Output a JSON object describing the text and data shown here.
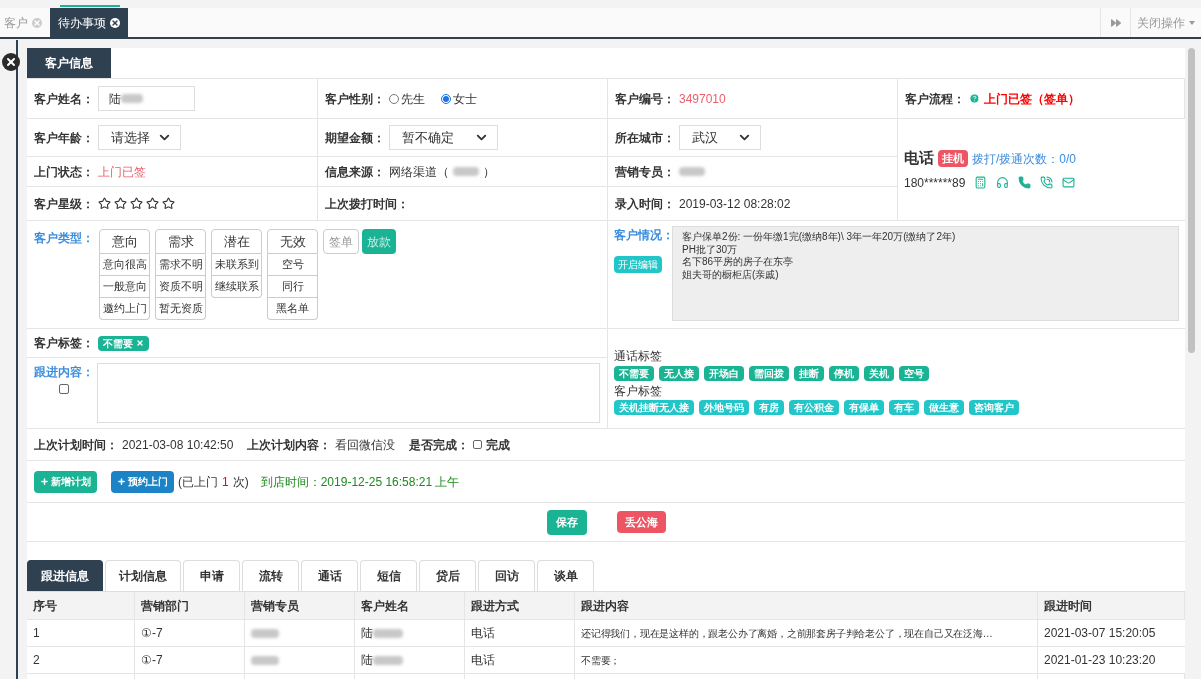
{
  "top_tabs": [
    {
      "label": "客户",
      "selected": false
    },
    {
      "label": "待办事项",
      "selected": true
    }
  ],
  "close_menu": "关闭操作",
  "panel_tab": "客户信息",
  "name": {
    "label": "客户姓名：",
    "value": "陆"
  },
  "gender": {
    "label": "客户性别：",
    "options": [
      {
        "label": "先生",
        "selected": false
      },
      {
        "label": "女士",
        "selected": true
      }
    ]
  },
  "number": {
    "label": "客户编号：",
    "value": "3497010"
  },
  "flow": {
    "label": "客户流程：",
    "value": "上门已签（签单）"
  },
  "age": {
    "label": "客户年龄：",
    "value": "请选择"
  },
  "amount": {
    "label": "期望金额：",
    "value": "暂不确定"
  },
  "city": {
    "label": "所在城市：",
    "value": "武汉"
  },
  "visit_status": {
    "label": "上门状态：",
    "value": "上门已签"
  },
  "source": {
    "label": "信息来源：",
    "value": "网络渠道（",
    "close": "）"
  },
  "sales": {
    "label": "营销专员："
  },
  "rating": {
    "label": "客户星级：",
    "stars": 0
  },
  "last_call": {
    "label": "上次拨打时间："
  },
  "created": {
    "label": "录入时间：",
    "value": "2019-03-12 08:28:02"
  },
  "phone": {
    "title": "电话",
    "hangup": "挂机",
    "counts": "拨打/拨通次数：0/0",
    "number": "180******89"
  },
  "customer_type": {
    "label": "客户类型：",
    "groups": [
      {
        "title": "意向",
        "items": [
          "意向很高",
          "一般意向",
          "邀约上门"
        ]
      },
      {
        "title": "需求",
        "items": [
          "需求不明",
          "资质不明",
          "暂无资质"
        ]
      },
      {
        "title": "潜在",
        "items": [
          "未联系到",
          "继续联系"
        ]
      },
      {
        "title": "无效",
        "items": [
          "空号",
          "同行",
          "黑名单"
        ]
      }
    ],
    "buttons": [
      {
        "label": "签单",
        "kind": "outline"
      },
      {
        "label": "放款",
        "kind": "solid"
      }
    ]
  },
  "situation": {
    "label": "客户情况：",
    "edit_button": "开启编辑",
    "lines": [
      "客户保单2份: 一份年缴1完(缴纳8年)\\ 3年一年20万(缴纳了2年)",
      "PH批了30万",
      "名下86平房的房子在东亭",
      "姐夫哥的橱柜店(亲戚)"
    ]
  },
  "tags": {
    "label": "客户标签：",
    "items": [
      "不需要"
    ]
  },
  "follow": {
    "label": "跟进内容：",
    "checked": false
  },
  "call_tags": {
    "title": "通话标签",
    "items": [
      "不需要",
      "无人接",
      "开场白",
      "需回拨",
      "挂断",
      "停机",
      "关机",
      "空号"
    ]
  },
  "customer_tags": {
    "title": "客户标签",
    "items": [
      "关机挂断无人接",
      "外地号码",
      "有房",
      "有公积金",
      "有保单",
      "有车",
      "做生意",
      "咨询客户"
    ]
  },
  "plan": {
    "time_label": "上次计划时间：",
    "time": "2021-03-08 10:42:50",
    "content_label": "上次计划内容：",
    "content": "看回微信没",
    "done_label": "是否完成：",
    "done_option": "完成",
    "checked": false
  },
  "actions": {
    "add_plan": "新增计划",
    "book": "预约上门",
    "visited_prefix": "(已上门",
    "visited_count": "1",
    "visited_suffix": "次)",
    "arrival": "到店时间：2019-12-25 16:58:21 上午"
  },
  "save": "保存",
  "discard": "丢公海",
  "bottom_tabs": [
    {
      "label": "跟进信息",
      "selected": true
    },
    {
      "label": "计划信息",
      "selected": false
    },
    {
      "label": "申请",
      "selected": false
    },
    {
      "label": "流转",
      "selected": false
    },
    {
      "label": "通话",
      "selected": false
    },
    {
      "label": "短信",
      "selected": false
    },
    {
      "label": "贷后",
      "selected": false
    },
    {
      "label": "回访",
      "selected": false
    },
    {
      "label": "谈单",
      "selected": false
    }
  ],
  "table": {
    "columns": [
      "序号",
      "营销部门",
      "营销专员",
      "客户姓名",
      "跟进方式",
      "跟进内容",
      "跟进时间"
    ],
    "rows": [
      {
        "index": "1",
        "dept": "①-7",
        "customer": "陆",
        "method": "电话",
        "content": "还记得我们，现在是这样的，跟老公办了离婚，之前那套房子判给老公了，现在自己又在泛海…",
        "time": "2021-03-07 15:20:05"
      },
      {
        "index": "2",
        "dept": "①-7",
        "customer": "陆",
        "method": "电话",
        "content": "不需要；",
        "time": "2021-01-23 10:23:20"
      }
    ]
  }
}
